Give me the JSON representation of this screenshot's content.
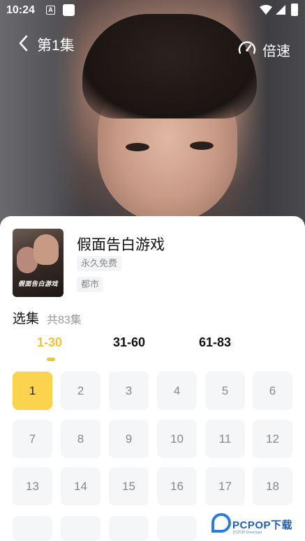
{
  "status_bar": {
    "time": "10:24",
    "app_icon_letter": "A"
  },
  "header": {
    "episode_title": "第1集",
    "speed_label": "倍速"
  },
  "drama": {
    "title": "假面告白游戏",
    "poster_text": "假面告白游戏",
    "tags": [
      "永久免费",
      "都市"
    ]
  },
  "episodes": {
    "section_label": "选集",
    "total_label": "共83集",
    "ranges": [
      "1-30",
      "31-60",
      "61-83"
    ],
    "active_range": 0,
    "active_episode": 1,
    "visible": [
      1,
      2,
      3,
      4,
      5,
      6,
      7,
      8,
      9,
      10,
      11,
      12,
      13,
      14,
      15,
      16,
      17,
      18
    ]
  },
  "watermark": {
    "text": "PCPOP下载",
    "sub": "PCPOP Download"
  },
  "colors": {
    "accent": "#f4c430",
    "active_episode_bg": "#fcd34d",
    "episode_bg": "#f5f6f8"
  }
}
